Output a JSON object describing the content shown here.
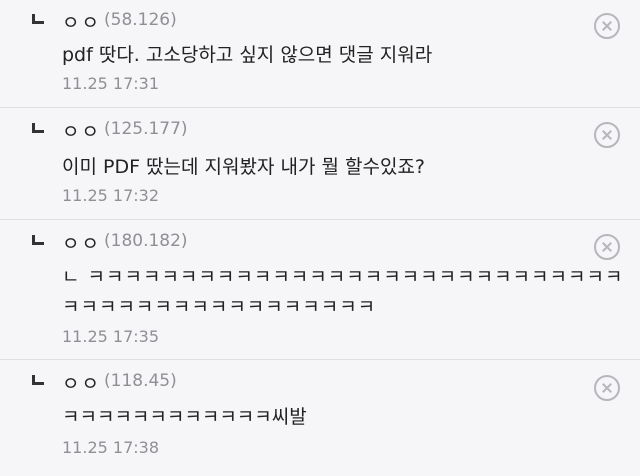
{
  "comments": [
    {
      "author": "ㅇㅇ",
      "ip": "(58.126)",
      "text": "pdf 땃다. 고소당하고 싶지 않으면 댓글 지워라",
      "time": "11.25 17:31",
      "delete_icon": "close-circle-icon"
    },
    {
      "author": "ㅇㅇ",
      "ip": "(125.177)",
      "text": "이미 PDF 땄는데 지워봤자 내가 뭘 할수있죠?",
      "time": "11.25 17:32",
      "delete_icon": "close-circle-icon"
    },
    {
      "author": "ㅇㅇ",
      "ip": "(180.182)",
      "text": "ㄴ ㅋㅋㅋㅋㅋㅋㅋㅋㅋㅋㅋㅋㅋㅋㅋㅋㅋㅋㅋㅋㅋㅋㅋㅋㅋㅋㅋㅋㅋㅋㅋㅋㅋㅋㅋㅋㅋㅋㅋㅋㅋㅋㅋㅋㅋㅋ",
      "time": "11.25 17:35",
      "delete_icon": "close-circle-icon"
    },
    {
      "author": "ㅇㅇ",
      "ip": "(118.45)",
      "text": "ㅋㅋㅋㅋㅋㅋㅋㅋㅋㅋㅋㅋ씨발",
      "time": "11.25 17:38",
      "delete_icon": "close-circle-icon"
    }
  ]
}
